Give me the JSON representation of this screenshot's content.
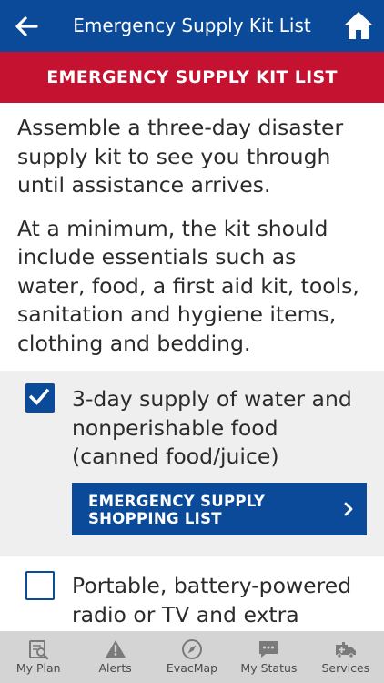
{
  "header": {
    "title": "Emergency Supply Kit List",
    "back_icon": "arrow-left-icon",
    "home_icon": "home-icon"
  },
  "banner": {
    "text": "EMERGENCY SUPPLY KIT LIST"
  },
  "intro": {
    "paragraph1": "Assemble a three-day disaster supply kit to see you through until assistance arrives.",
    "paragraph2": "At a minimum, the kit should include essentials such as water, food, a first aid kit, tools, sanitation and hygiene items, clothing and bedding."
  },
  "checklist": [
    {
      "text": "3-day supply of water and nonperishable food (canned food/juice)",
      "checked": true,
      "button_label": "EMERGENCY SUPPLY SHOPPING LIST"
    },
    {
      "text": "Portable, battery-powered radio or TV and extra",
      "checked": false
    }
  ],
  "tabbar": {
    "tabs": [
      {
        "label": "My Plan",
        "icon": "plan-search-icon"
      },
      {
        "label": "Alerts",
        "icon": "warning-icon"
      },
      {
        "label": "EvacMap",
        "icon": "compass-icon"
      },
      {
        "label": "My Status",
        "icon": "chat-bubble-icon"
      },
      {
        "label": "Services",
        "icon": "ambulance-icon"
      }
    ]
  },
  "colors": {
    "header_blue": "#0b4a99",
    "banner_red": "#c41230",
    "tabbar_gray": "#d4d4d4",
    "checked_row_bg": "#efefef"
  }
}
